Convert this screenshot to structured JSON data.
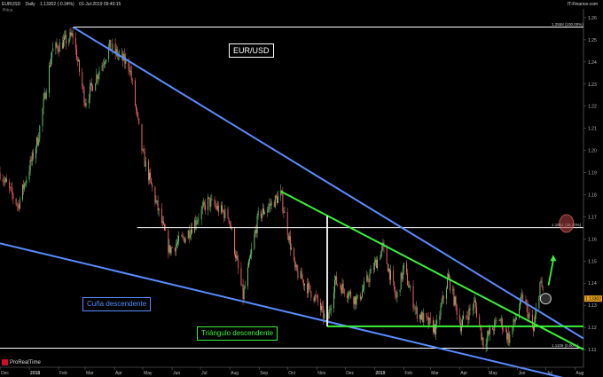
{
  "header": {
    "symbol": "EURUSD",
    "period": "Daily",
    "quote": "1.13302 (-0.34%)",
    "datetime": "01-Jul-2019 09:40:15",
    "brand": "IT-Finance.com"
  },
  "price_axis_label": "Price",
  "logo_text": "ProRealTime",
  "annotations": {
    "title_box": "EUR/USD",
    "wedge_box": "Cuña descendente",
    "triangle_box": "Triángulo descendente"
  },
  "colors": {
    "background": "#000000",
    "candle_up": "#6fcf6f",
    "candle_down": "#ff6a6a",
    "wedge_lines": "#5a8cff",
    "triangle_lines": "#3cf03c",
    "fib_lines": "#ffffff",
    "circle_fill": "#b04040"
  },
  "chart_data": {
    "type": "candlestick",
    "x_axis_type": "date",
    "y_axis_side": "right",
    "ylim": [
      1.102,
      1.264
    ],
    "xlim": [
      "2017-12-01",
      "2019-08-10"
    ],
    "x_tick_labels": [
      {
        "label": "Dec",
        "date": "2017-12-01"
      },
      {
        "label": "2018",
        "date": "2018-01-01"
      },
      {
        "label": "Feb",
        "date": "2018-02-01"
      },
      {
        "label": "Mar",
        "date": "2018-03-01"
      },
      {
        "label": "Apr",
        "date": "2018-04-01"
      },
      {
        "label": "May",
        "date": "2018-05-01"
      },
      {
        "label": "Jun",
        "date": "2018-06-01"
      },
      {
        "label": "Jul",
        "date": "2018-07-01"
      },
      {
        "label": "Aug",
        "date": "2018-08-01"
      },
      {
        "label": "Sep",
        "date": "2018-09-01"
      },
      {
        "label": "Oct",
        "date": "2018-10-01"
      },
      {
        "label": "Nov",
        "date": "2018-11-01"
      },
      {
        "label": "Dec",
        "date": "2018-12-01"
      },
      {
        "label": "2019",
        "date": "2019-01-01"
      },
      {
        "label": "Feb",
        "date": "2019-02-01"
      },
      {
        "label": "Mar",
        "date": "2019-03-01"
      },
      {
        "label": "Apr",
        "date": "2019-04-01"
      },
      {
        "label": "May",
        "date": "2019-05-01"
      },
      {
        "label": "Jun",
        "date": "2019-06-01"
      },
      {
        "label": "Jul",
        "date": "2019-07-01"
      },
      {
        "label": "Aug",
        "date": "2019-08-01"
      }
    ],
    "y_ticks": [
      1.11,
      1.12,
      1.13,
      1.14,
      1.15,
      1.16,
      1.17,
      1.18,
      1.19,
      1.2,
      1.21,
      1.22,
      1.23,
      1.24,
      1.25,
      1.26
    ],
    "price_path": [
      {
        "date": "2017-12-01",
        "value": 1.19
      },
      {
        "date": "2017-12-20",
        "value": 1.175
      },
      {
        "date": "2018-01-10",
        "value": 1.205
      },
      {
        "date": "2018-01-25",
        "value": 1.245
      },
      {
        "date": "2018-02-16",
        "value": 1.252
      },
      {
        "date": "2018-03-01",
        "value": 1.222
      },
      {
        "date": "2018-03-27",
        "value": 1.247
      },
      {
        "date": "2018-04-17",
        "value": 1.238
      },
      {
        "date": "2018-05-01",
        "value": 1.198
      },
      {
        "date": "2018-05-29",
        "value": 1.155
      },
      {
        "date": "2018-06-15",
        "value": 1.161
      },
      {
        "date": "2018-07-09",
        "value": 1.177
      },
      {
        "date": "2018-07-31",
        "value": 1.17
      },
      {
        "date": "2018-08-15",
        "value": 1.134
      },
      {
        "date": "2018-08-31",
        "value": 1.17
      },
      {
        "date": "2018-09-24",
        "value": 1.18
      },
      {
        "date": "2018-10-09",
        "value": 1.146
      },
      {
        "date": "2018-10-31",
        "value": 1.133
      },
      {
        "date": "2018-11-12",
        "value": 1.122
      },
      {
        "date": "2018-11-20",
        "value": 1.141
      },
      {
        "date": "2018-12-14",
        "value": 1.132
      },
      {
        "date": "2019-01-10",
        "value": 1.156
      },
      {
        "date": "2019-01-24",
        "value": 1.133
      },
      {
        "date": "2019-02-01",
        "value": 1.147
      },
      {
        "date": "2019-02-14",
        "value": 1.127
      },
      {
        "date": "2019-03-07",
        "value": 1.119
      },
      {
        "date": "2019-03-20",
        "value": 1.143
      },
      {
        "date": "2019-04-02",
        "value": 1.121
      },
      {
        "date": "2019-04-17",
        "value": 1.131
      },
      {
        "date": "2019-04-26",
        "value": 1.113
      },
      {
        "date": "2019-05-13",
        "value": 1.124
      },
      {
        "date": "2019-05-23",
        "value": 1.115
      },
      {
        "date": "2019-06-07",
        "value": 1.134
      },
      {
        "date": "2019-06-18",
        "value": 1.118
      },
      {
        "date": "2019-06-25",
        "value": 1.14
      },
      {
        "date": "2019-07-01",
        "value": 1.133
      }
    ],
    "current_price_label": "1.13302",
    "horizontal_levels": [
      {
        "label": "1.2558 (100.00%)",
        "value": 1.2558,
        "start": "2018-02-16",
        "end": "2019-08-10"
      },
      {
        "label": "1.1651 (38.20%)",
        "value": 1.1651,
        "start": "2018-04-25",
        "end": "2019-08-10"
      },
      {
        "label": "1.1106 (0.00%)",
        "value": 1.1106,
        "start": "2017-12-01",
        "end": "2019-08-10"
      }
    ],
    "trendlines": [
      {
        "name": "wedge_upper",
        "color": "wedge",
        "from": [
          "2018-02-16",
          1.2558
        ],
        "to": [
          "2019-08-10",
          1.115
        ]
      },
      {
        "name": "wedge_lower",
        "color": "wedge",
        "from": [
          "2017-12-01",
          1.158
        ],
        "to": [
          "2019-08-10",
          1.095
        ]
      },
      {
        "name": "triangle_upper",
        "color": "triangle",
        "from": [
          "2018-09-24",
          1.1815
        ],
        "to": [
          "2019-08-10",
          1.11
        ]
      },
      {
        "name": "triangle_base",
        "color": "triangle",
        "from": [
          "2018-11-12",
          1.1205
        ],
        "to": [
          "2019-08-10",
          1.1205
        ]
      },
      {
        "name": "triangle_left_edge",
        "color": "fib",
        "from": [
          "2018-11-12",
          1.1705
        ],
        "to": [
          "2018-11-12",
          1.1205
        ]
      }
    ],
    "target_arrow": {
      "from": [
        "2019-07-04",
        1.139
      ],
      "to": [
        "2019-07-09",
        1.152
      ]
    },
    "highlight_circles": [
      {
        "center": [
          "2019-07-23",
          1.167
        ],
        "kind": "fill"
      },
      {
        "center": [
          "2019-07-01",
          1.133
        ],
        "kind": "outline"
      }
    ]
  }
}
